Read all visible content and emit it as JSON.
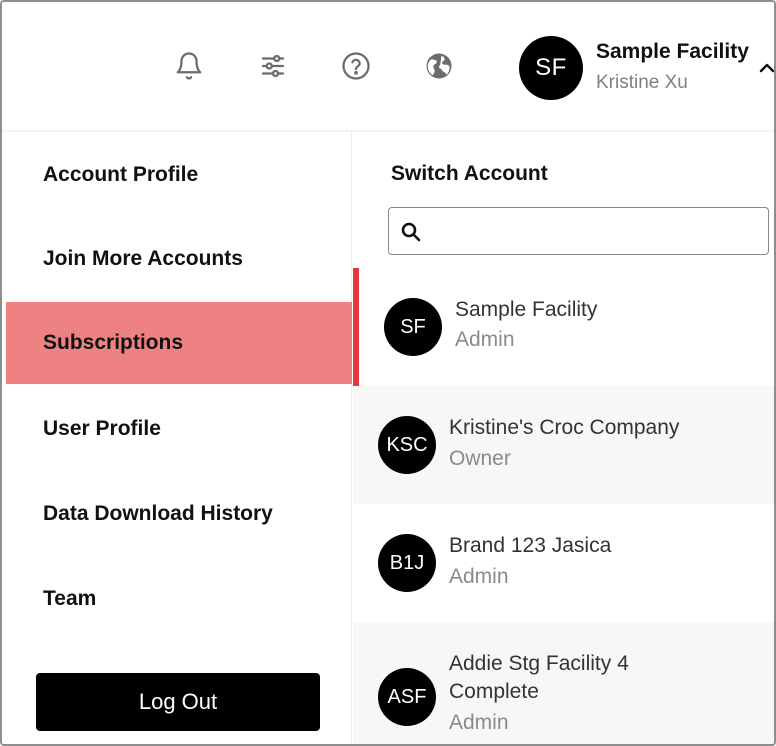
{
  "header": {
    "icons": [
      "bell-icon",
      "sliders-icon",
      "help-icon",
      "globe-icon"
    ],
    "user": {
      "initials": "SF",
      "name": "Sample Facility",
      "subtitle": "Kristine Xu"
    }
  },
  "menu": {
    "items": [
      {
        "label": "Account Profile",
        "active": false
      },
      {
        "label": "Join More Accounts",
        "active": false
      },
      {
        "label": "Subscriptions",
        "active": true
      },
      {
        "label": "User Profile",
        "active": false
      },
      {
        "label": "Data Download History",
        "active": false
      },
      {
        "label": "Team",
        "active": false
      }
    ],
    "logout_label": "Log Out"
  },
  "switch": {
    "title": "Switch Account",
    "search_value": "",
    "accounts": [
      {
        "initials": "SF",
        "name": "Sample Facility",
        "role": "Admin",
        "selected": true
      },
      {
        "initials": "KSC",
        "name": "Kristine's Croc Company",
        "role": "Owner",
        "selected": false
      },
      {
        "initials": "B1J",
        "name": "Brand 123 Jasica",
        "role": "Admin",
        "selected": false
      },
      {
        "initials": "ASF",
        "name_line1": "Addie Stg Facility 4",
        "name_line2": "Complete",
        "role": "Admin",
        "selected": false
      }
    ]
  },
  "colors": {
    "active_menu_bg": "#ee8282",
    "active_indicator": "#e8363c",
    "avatar_bg": "#000000",
    "alt_row_bg": "#f7f7f7"
  }
}
